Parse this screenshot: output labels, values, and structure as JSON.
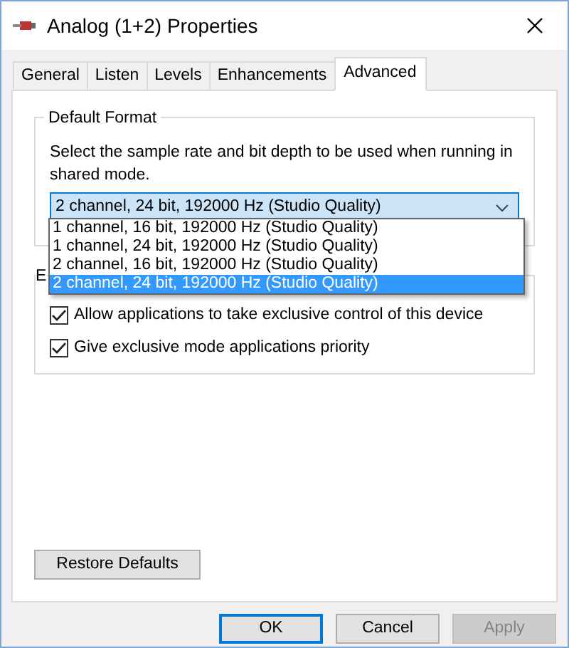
{
  "window": {
    "title": "Analog (1+2) Properties"
  },
  "tabs": [
    {
      "label": "General",
      "selected": false
    },
    {
      "label": "Listen",
      "selected": false
    },
    {
      "label": "Levels",
      "selected": false
    },
    {
      "label": "Enhancements",
      "selected": false
    },
    {
      "label": "Advanced",
      "selected": true
    }
  ],
  "default_format": {
    "legend": "Default Format",
    "description": "Select the sample rate and bit depth to be used when running in shared mode.",
    "dropdown": {
      "value": "2 channel, 24 bit, 192000 Hz (Studio Quality)",
      "expanded": true,
      "options": [
        {
          "label": "1 channel, 16 bit, 192000 Hz (Studio Quality)",
          "selected": false
        },
        {
          "label": "1 channel, 24 bit, 192000 Hz (Studio Quality)",
          "selected": false
        },
        {
          "label": "2 channel, 16 bit, 192000 Hz (Studio Quality)",
          "selected": false
        },
        {
          "label": "2 channel, 24 bit, 192000 Hz (Studio Quality)",
          "selected": true
        }
      ]
    }
  },
  "exclusive_mode": {
    "legend": "E",
    "checkboxes": [
      {
        "label": "Allow applications to take exclusive control of this device",
        "checked": true
      },
      {
        "label": "Give exclusive mode applications priority",
        "checked": true
      }
    ]
  },
  "restore_button": "Restore Defaults",
  "buttons": [
    {
      "label": "OK",
      "default": true,
      "disabled": false
    },
    {
      "label": "Cancel",
      "default": false,
      "disabled": false
    },
    {
      "label": "Apply",
      "default": false,
      "disabled": true
    }
  ]
}
